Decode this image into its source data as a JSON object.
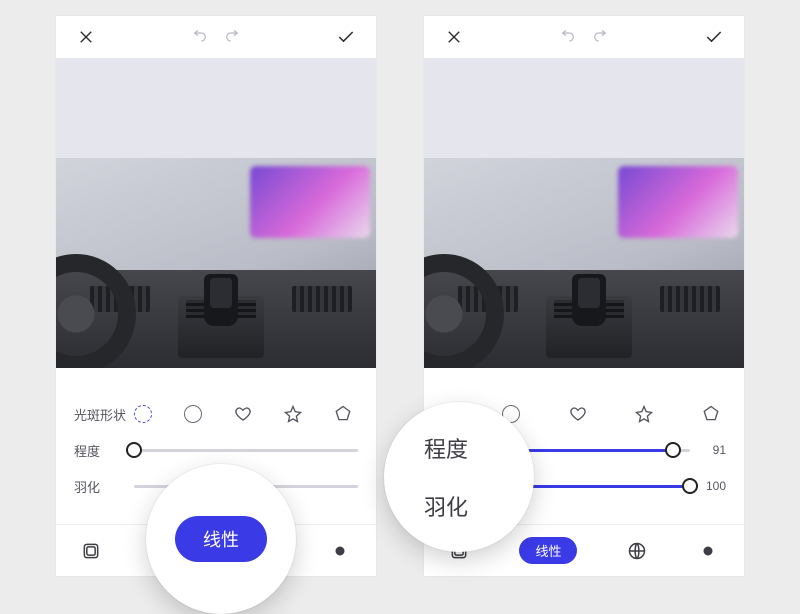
{
  "topbar": {
    "close": "close-icon",
    "undo": "undo-icon",
    "redo": "redo-icon",
    "confirm": "check-icon"
  },
  "shapes_row": {
    "label": "光斑形状",
    "options": [
      "dashed-circle",
      "circle",
      "heart",
      "star",
      "pentagon"
    ],
    "selected_index": 0
  },
  "sliders": {
    "intensity": {
      "label": "程度",
      "value_left": 0,
      "value_right": 91,
      "max": 100
    },
    "feather": {
      "label": "羽化",
      "value_right": 100,
      "max": 100
    }
  },
  "bottom": {
    "linear_label": "线性",
    "items": [
      "layers-icon",
      "linear-pill",
      "globe-icon",
      "dot-icon"
    ]
  },
  "zoom_left": {
    "label": "线性"
  },
  "zoom_right": {
    "label1": "程度",
    "label2": "羽化"
  }
}
